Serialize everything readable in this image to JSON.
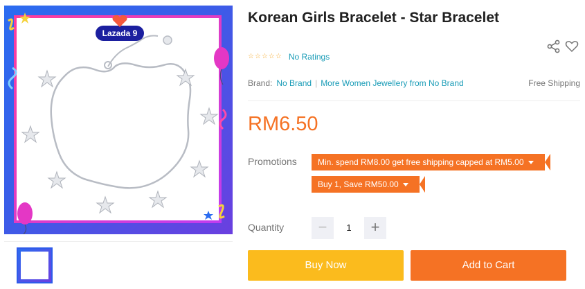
{
  "product": {
    "title": "Korean Girls Bracelet - Star Bracelet",
    "rating_text": "No Ratings",
    "rating_stars": 0,
    "rating_max": 5,
    "brand_label": "Brand:",
    "brand_name": "No Brand",
    "separator": "|",
    "more_from_brand": "More Women Jewellery from No Brand",
    "free_shipping": "Free Shipping",
    "price": "RM6.50"
  },
  "gallery": {
    "badge_text": "Lazada 9",
    "thumbnail_count": 1
  },
  "promotions": {
    "label": "Promotions",
    "items": [
      {
        "text": "Min. spend RM8.00 get free shipping capped at RM5.00"
      },
      {
        "text": "Buy 1, Save RM50.00"
      }
    ]
  },
  "quantity": {
    "label": "Quantity",
    "value": "1",
    "minus": "−",
    "plus": "+"
  },
  "actions": {
    "buy_now": "Buy Now",
    "add_to_cart": "Add to Cart"
  },
  "icons": {
    "share": "share-icon",
    "wishlist": "heart-icon",
    "star": "star-outline-icon"
  },
  "colors": {
    "accent_orange": "#f57224",
    "buy_yellow": "#fbbb1d",
    "link_teal": "#1a9cb7",
    "star_gold": "#f5a623"
  }
}
